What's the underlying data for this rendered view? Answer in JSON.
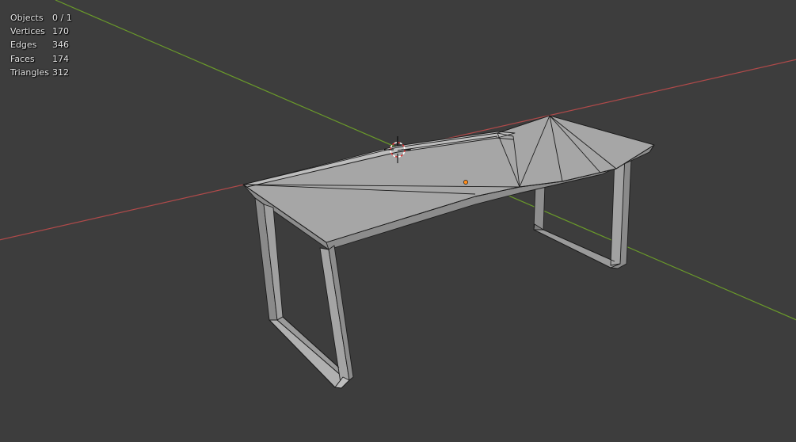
{
  "viewport": {
    "background": "#3d3d3d",
    "axis_x_color": "#b04a4a",
    "axis_y_color": "#6a9a2a",
    "origin_color": "#ff8c1a",
    "cursor_color": "#d83a3a"
  },
  "stats": {
    "objects_label": "Objects",
    "objects_value": "0 / 1",
    "vertices_label": "Vertices",
    "vertices_value": "170",
    "edges_label": "Edges",
    "edges_value": "346",
    "faces_label": "Faces",
    "faces_value": "174",
    "triangles_label": "Triangles",
    "triangles_value": "312"
  }
}
